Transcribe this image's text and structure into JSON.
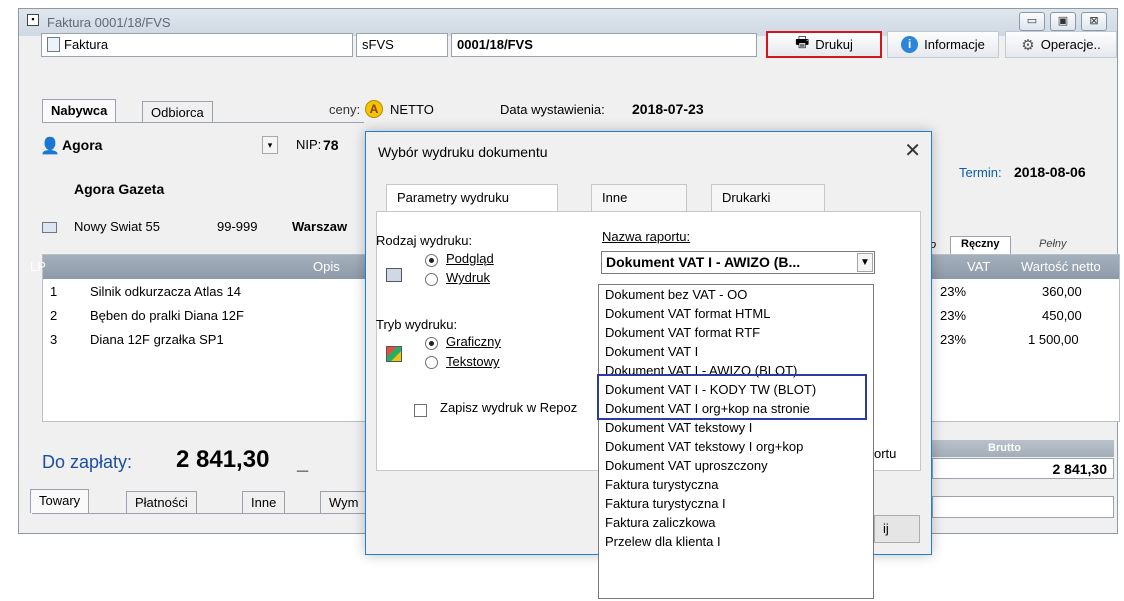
{
  "window": {
    "title": "Faktura 0001/18/FVS",
    "minimize_glyph": "▭",
    "maximize_glyph": "▣",
    "close_glyph": "⊠"
  },
  "toolbar": {
    "doc_type": "Faktura",
    "series": "sFVS",
    "number": "0001/18/FVS",
    "print_label": "Drukuj",
    "info_label": "Informacje",
    "operations_label": "Operacje.."
  },
  "header": {
    "tabs": [
      "Nabywca",
      "Odbiorca"
    ],
    "prices_label": "ceny:",
    "prices_badge": "A",
    "prices_value": "NETTO",
    "issue_date_label": "Data wystawienia:",
    "issue_date": "2018-07-23",
    "due_label": "Termin:",
    "due_date": "2018-08-06"
  },
  "customer": {
    "name": "Agora",
    "nip_label": "NIP:",
    "nip_partial": "78",
    "full_name": "Agora Gazeta",
    "street": "Nowy Swiat 55",
    "postcode": "99-999",
    "city_partial": "Warszaw"
  },
  "grid": {
    "columns": [
      "LP",
      "Opis",
      "VAT",
      "Wartość netto"
    ],
    "view_tabs": [
      "o",
      "Ręczny",
      "Pełny"
    ],
    "rows": [
      {
        "lp": "1",
        "desc": "Silnik odkurzacza Atlas 14",
        "vat": "23%",
        "net": "360,00"
      },
      {
        "lp": "2",
        "desc": "Bęben do pralki Diana 12F",
        "vat": "23%",
        "net": "450,00"
      },
      {
        "lp": "3",
        "desc": "Diana 12F grzałka SP1",
        "vat": "23%",
        "net": "1 500,00"
      }
    ]
  },
  "summary": {
    "to_pay_label": "Do zapłaty:",
    "to_pay_value": "2 841,30",
    "brutto_label": "Brutto",
    "brutto_value": "2 841,30"
  },
  "bottom_tabs": [
    "Towary",
    "Płatności",
    "Inne",
    "Wym"
  ],
  "dialog": {
    "title": "Wybór wydruku dokumentu",
    "close_glyph": "✕",
    "tabs": [
      "Parametry wydruku",
      "Inne",
      "Drukarki"
    ],
    "print_kind_label": "Rodzaj wydruku:",
    "print_kind_options": [
      "Podgląd",
      "Wydruk"
    ],
    "print_mode_label": "Tryb wydruku:",
    "print_mode_options": [
      "Graficzny",
      "Tekstowy"
    ],
    "save_repo_label": "Zapisz wydruk w Repoz",
    "report_name_label": "Nazwa raportu:",
    "report_selected": "Dokument VAT I - AWIZO (B...",
    "partial_right_label": "ortu",
    "partial_button_label": "ij",
    "report_options": [
      "Dokument bez VAT - OO",
      "Dokument VAT format HTML",
      "Dokument VAT format RTF",
      "Dokument VAT I",
      "Dokument VAT I - AWIZO (BLOT)",
      "Dokument VAT I - KODY TW (BLOT)",
      "Dokument VAT I org+kop na stronie",
      "Dokument VAT tekstowy I",
      "Dokument VAT tekstowy I org+kop",
      "Dokument VAT uproszczony",
      "Faktura turystyczna",
      "Faktura turystyczna I",
      "Faktura zaliczkowa",
      "Przelew dla klienta I"
    ]
  },
  "colors": {
    "accent_blue": "#1f7fd6",
    "highlight_red": "#d4161c",
    "highlight_navy": "#2c3aa8",
    "grid_header": "#9aa6b4"
  }
}
